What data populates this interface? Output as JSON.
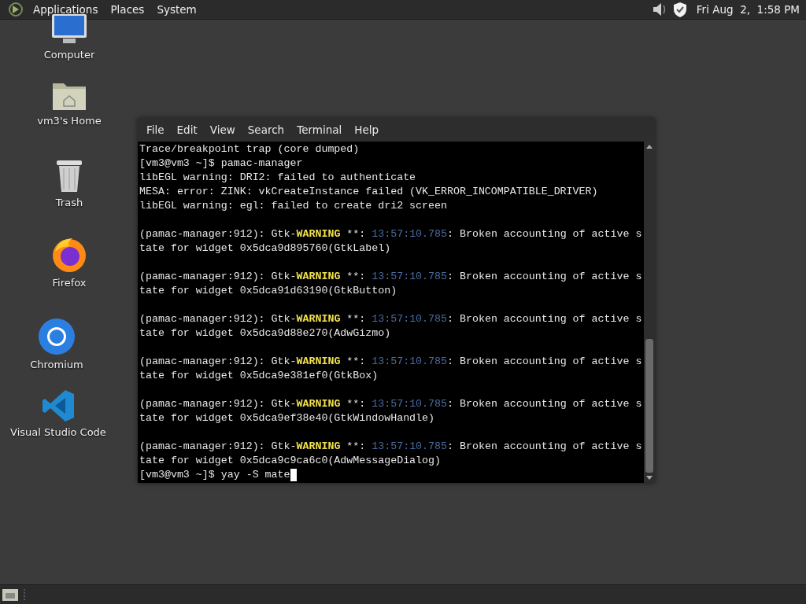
{
  "top_panel": {
    "menus": [
      "Applications",
      "Places",
      "System"
    ],
    "clock": "Fri Aug  2,  1:58 PM"
  },
  "desktop_icons": [
    {
      "label": "Computer",
      "kind": "computer"
    },
    {
      "label": "vm3's Home",
      "kind": "folder"
    },
    {
      "label": "Trash",
      "kind": "trash"
    },
    {
      "label": "Firefox",
      "kind": "firefox"
    },
    {
      "label": "Chromium",
      "kind": "chromium"
    },
    {
      "label": "Visual Studio Code",
      "kind": "vscode"
    }
  ],
  "terminal": {
    "menus": [
      "File",
      "Edit",
      "View",
      "Search",
      "Terminal",
      "Help"
    ],
    "lines": [
      {
        "kind": "text",
        "text": "Trace/breakpoint trap (core dumped)"
      },
      {
        "kind": "text",
        "text": "[vm3@vm3 ~]$ pamac-manager"
      },
      {
        "kind": "text",
        "text": "libEGL warning: DRI2: failed to authenticate"
      },
      {
        "kind": "text",
        "text": "MESA: error: ZINK: vkCreateInstance failed (VK_ERROR_INCOMPATIBLE_DRIVER)"
      },
      {
        "kind": "text",
        "text": "libEGL warning: egl: failed to create dri2 screen"
      },
      {
        "kind": "blank"
      },
      {
        "kind": "warning",
        "source": "(pamac-manager:912): Gtk-",
        "severity": "WARNING",
        "separator": " **: ",
        "time": "13:57:10.785",
        "message": ": Broken accounting of active s"
      },
      {
        "kind": "text",
        "text": "tate for widget 0x5dca9d895760(GtkLabel)"
      },
      {
        "kind": "blank"
      },
      {
        "kind": "warning",
        "source": "(pamac-manager:912): Gtk-",
        "severity": "WARNING",
        "separator": " **: ",
        "time": "13:57:10.785",
        "message": ": Broken accounting of active s"
      },
      {
        "kind": "text",
        "text": "tate for widget 0x5dca91d63190(GtkButton)"
      },
      {
        "kind": "blank"
      },
      {
        "kind": "warning",
        "source": "(pamac-manager:912): Gtk-",
        "severity": "WARNING",
        "separator": " **: ",
        "time": "13:57:10.785",
        "message": ": Broken accounting of active s"
      },
      {
        "kind": "text",
        "text": "tate for widget 0x5dca9d88e270(AdwGizmo)"
      },
      {
        "kind": "blank"
      },
      {
        "kind": "warning",
        "source": "(pamac-manager:912): Gtk-",
        "severity": "WARNING",
        "separator": " **: ",
        "time": "13:57:10.785",
        "message": ": Broken accounting of active s"
      },
      {
        "kind": "text",
        "text": "tate for widget 0x5dca9e381ef0(GtkBox)"
      },
      {
        "kind": "blank"
      },
      {
        "kind": "warning",
        "source": "(pamac-manager:912): Gtk-",
        "severity": "WARNING",
        "separator": " **: ",
        "time": "13:57:10.785",
        "message": ": Broken accounting of active s"
      },
      {
        "kind": "text",
        "text": "tate for widget 0x5dca9ef38e40(GtkWindowHandle)"
      },
      {
        "kind": "blank"
      },
      {
        "kind": "warning",
        "source": "(pamac-manager:912): Gtk-",
        "severity": "WARNING",
        "separator": " **: ",
        "time": "13:57:10.785",
        "message": ": Broken accounting of active s"
      },
      {
        "kind": "text",
        "text": "tate for widget 0x5dca9c9ca6c0(AdwMessageDialog)"
      }
    ],
    "prompt": "[vm3@vm3 ~]$ yay -S mate"
  }
}
